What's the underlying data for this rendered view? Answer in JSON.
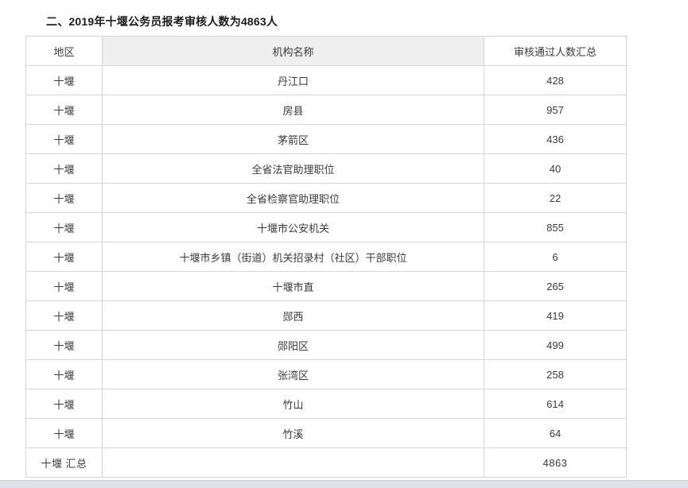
{
  "section": {
    "title": "二、2019年十堰公务员报考审核人数为4863人"
  },
  "table": {
    "headers": {
      "region": "地区",
      "org": "机构名称",
      "count": "审核通过人数汇总"
    },
    "rows": [
      {
        "region": "十堰",
        "org": "丹江口",
        "count": "428"
      },
      {
        "region": "十堰",
        "org": "房县",
        "count": "957"
      },
      {
        "region": "十堰",
        "org": "茅箭区",
        "count": "436"
      },
      {
        "region": "十堰",
        "org": "全省法官助理职位",
        "count": "40"
      },
      {
        "region": "十堰",
        "org": "全省检察官助理职位",
        "count": "22"
      },
      {
        "region": "十堰",
        "org": "十堰市公安机关",
        "count": "855"
      },
      {
        "region": "十堰",
        "org": "十堰市乡镇（街道）机关招录村（社区）干部职位",
        "count": "6"
      },
      {
        "region": "十堰",
        "org": "十堰市直",
        "count": "265"
      },
      {
        "region": "十堰",
        "org": "郧西",
        "count": "419"
      },
      {
        "region": "十堰",
        "org": "郧阳区",
        "count": "499"
      },
      {
        "region": "十堰",
        "org": "张湾区",
        "count": "258"
      },
      {
        "region": "十堰",
        "org": "竹山",
        "count": "614"
      },
      {
        "region": "十堰",
        "org": "竹溪",
        "count": "64"
      }
    ],
    "total": {
      "label": "十堰 汇总",
      "org": "",
      "count": "4863"
    }
  },
  "colors": {
    "header_shade": "#efefef",
    "border": "#d4d4d4",
    "text": "#3a3a3a",
    "title": "#1a1a1a",
    "bottom_band": "#dfe2e9"
  }
}
